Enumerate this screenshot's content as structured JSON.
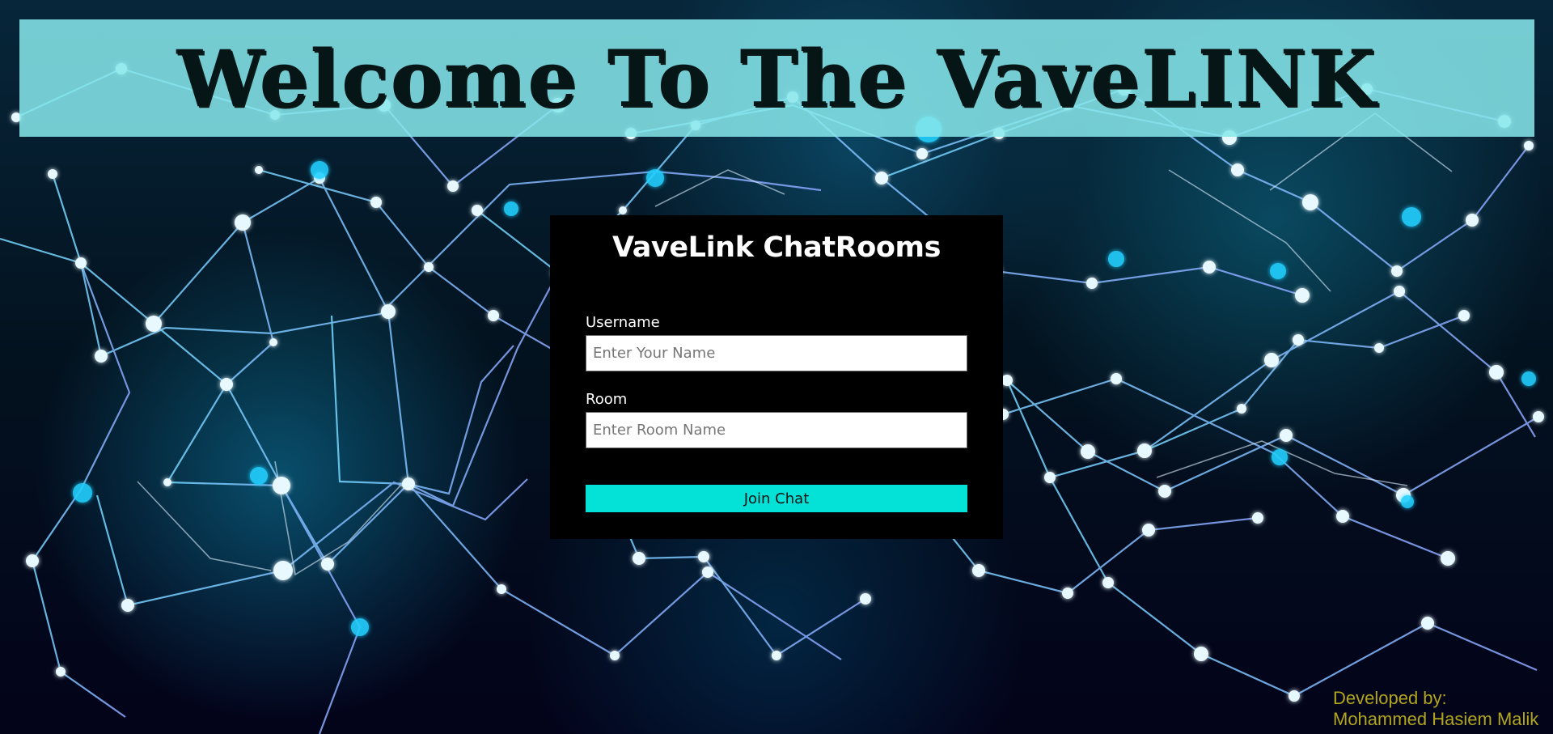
{
  "hero": {
    "title": "Welcome To The VaveLINK"
  },
  "login_card": {
    "title": "VaveLink ChatRooms",
    "username_label": "Username",
    "username_placeholder": "Enter Your Name",
    "username_value": "",
    "room_label": "Room",
    "room_placeholder": "Enter Room Name",
    "room_value": "",
    "join_button_label": "Join Chat"
  },
  "footer": {
    "credit_line_1": "Developed by:",
    "credit_line_2": "Mohammed Hasiem Malik"
  },
  "colors": {
    "banner": "#87E8EB",
    "button": "#04E2D8",
    "card": "#000000",
    "credit": "#B0A51C",
    "network_line": "#65B8FF",
    "network_node": "#EAF8FF"
  },
  "icons": {
    "background": "network-nodes-graphic"
  }
}
